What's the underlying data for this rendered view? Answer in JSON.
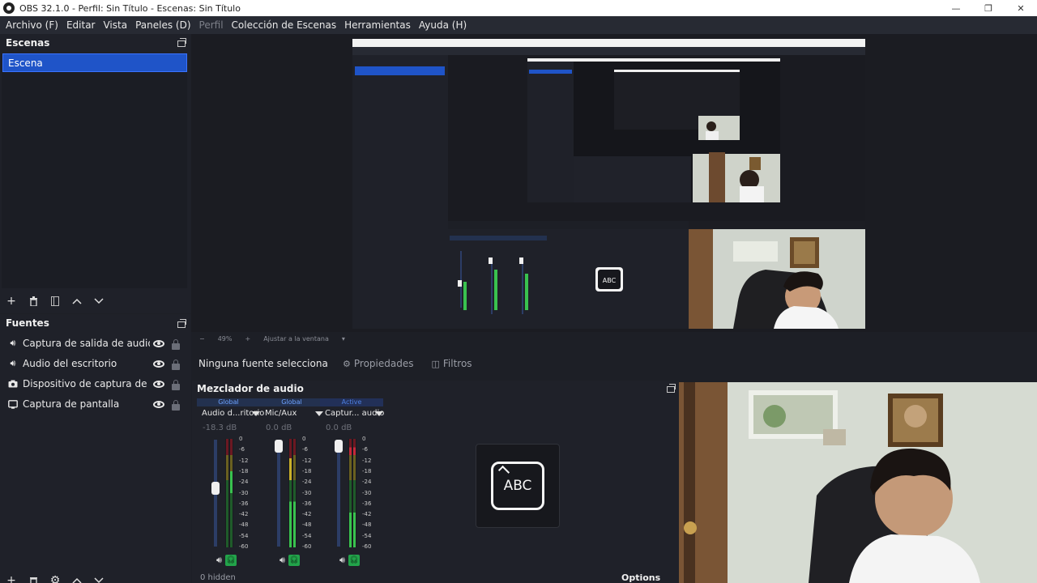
{
  "window": {
    "title": "OBS 32.1.0 - Perfil: Sin Título - Escenas: Sin Título",
    "controls": [
      "—",
      "❐",
      "✕"
    ]
  },
  "menu": [
    {
      "label": "Archivo (F)",
      "disabled": false
    },
    {
      "label": "Editar",
      "disabled": false
    },
    {
      "label": "Vista",
      "disabled": false
    },
    {
      "label": "Paneles (D)",
      "disabled": false
    },
    {
      "label": "Perfil",
      "disabled": true
    },
    {
      "label": "Colección de Escenas",
      "disabled": false
    },
    {
      "label": "Herramientas",
      "disabled": false
    },
    {
      "label": "Ayuda (H)",
      "disabled": false
    }
  ],
  "scenes": {
    "title": "Escenas",
    "items": [
      "Escena"
    ]
  },
  "sources": {
    "title": "Fuentes",
    "items": [
      {
        "label": "Captura de salida de audio",
        "icon": "speaker-icon"
      },
      {
        "label": "Audio del escritorio",
        "icon": "speaker-icon"
      },
      {
        "label": "Dispositivo de captura de vídeo",
        "icon": "camera-icon"
      },
      {
        "label": "Captura de pantalla",
        "icon": "monitor-icon"
      }
    ]
  },
  "preview_status": {
    "zoom": "49%",
    "fit": "Ajustar a la ventana"
  },
  "context_bar": {
    "no_source": "Ninguna fuente selecciona",
    "properties": "Propiedades",
    "filters": "Filtros"
  },
  "mixer": {
    "title": "Mezclador de audio",
    "channels": [
      {
        "badge": "Global",
        "name": "Audio d...ritorio",
        "db": "-18.3 dB",
        "level": 0.55
      },
      {
        "badge": "Global",
        "name": "Mic/Aux",
        "db": "0.0 dB",
        "level": 1.0
      },
      {
        "badge": "Active",
        "name": "Captur... audio",
        "db": "0.0 dB",
        "level": 1.0
      }
    ],
    "scale": [
      "0",
      "-6",
      "-12",
      "-18",
      "-24",
      "-30",
      "-36",
      "-42",
      "-48",
      "-54",
      "-60"
    ],
    "hidden": "0 hidden",
    "options": "Options"
  },
  "colors": {
    "accent": "#1f54c8",
    "meter_green": "#39c24f",
    "meter_yellow": "#c9b02a",
    "meter_red": "#c7283a"
  }
}
